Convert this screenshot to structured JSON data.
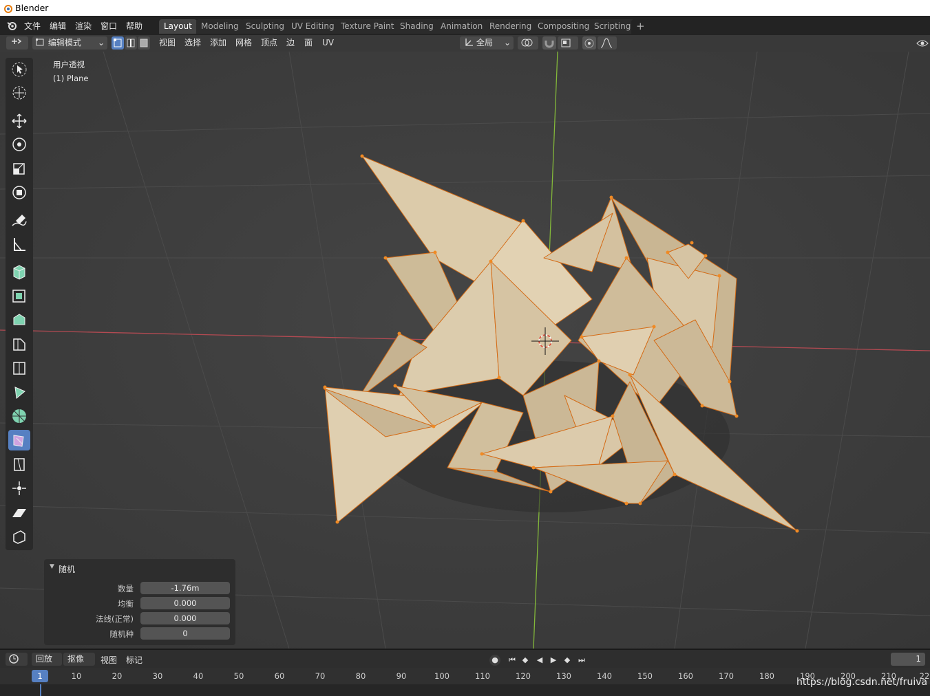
{
  "app": {
    "title": "Blender"
  },
  "menu": [
    "文件",
    "编辑",
    "渲染",
    "窗口",
    "帮助"
  ],
  "workspaces": [
    "Layout",
    "Modeling",
    "Sculpting",
    "UV Editing",
    "Texture Paint",
    "Shading",
    "Animation",
    "Rendering",
    "Compositing",
    "Scripting"
  ],
  "active_workspace": "Layout",
  "add_workspace": "+",
  "viewport_header": {
    "mode": "编辑模式",
    "menus": [
      "视图",
      "选择",
      "添加",
      "网格",
      "顶点",
      "边",
      "面",
      "UV"
    ],
    "orientation": "全局"
  },
  "viewport": {
    "view_name": "用户透视",
    "object_name": "(1) Plane",
    "mesh_color": "#d8c7a6",
    "edge_color": "#e07a1f",
    "x_axis_color": "#b34a52",
    "y_axis_color": "#83b83a"
  },
  "toolbar_icons": [
    "select-box-icon",
    "cursor-icon",
    "move-icon",
    "rotate-icon",
    "scale-icon",
    "transform-icon",
    "annotate-icon",
    "measure-icon",
    "add-cube-icon",
    "extrude-icon",
    "inset-icon",
    "bevel-icon",
    "loop-cut-icon",
    "knife-icon",
    "poly-build-icon",
    "spin-icon",
    "smooth-icon",
    "edge-slide-icon",
    "shrink-fatten-icon",
    "shear-icon",
    "rip-icon"
  ],
  "active_tool": "smooth-icon",
  "redo_panel": {
    "title": "随机",
    "fields": [
      {
        "label": "数量",
        "value": "-1.76m"
      },
      {
        "label": "均衡",
        "value": "0.000"
      },
      {
        "label": "法线(正常)",
        "value": "0.000"
      },
      {
        "label": "随机种",
        "value": "0"
      }
    ]
  },
  "timeline": {
    "menus": [
      "回放",
      "抠像",
      "视图",
      "标记"
    ],
    "current_frame": "1",
    "frame_field": "1",
    "ticks": [
      "10",
      "20",
      "30",
      "40",
      "50",
      "60",
      "70",
      "80",
      "90",
      "100",
      "110",
      "120",
      "130",
      "140",
      "150",
      "160",
      "170",
      "180",
      "190",
      "200",
      "210",
      "22"
    ]
  },
  "watermark": "https://blog.csdn.net/fruiva"
}
